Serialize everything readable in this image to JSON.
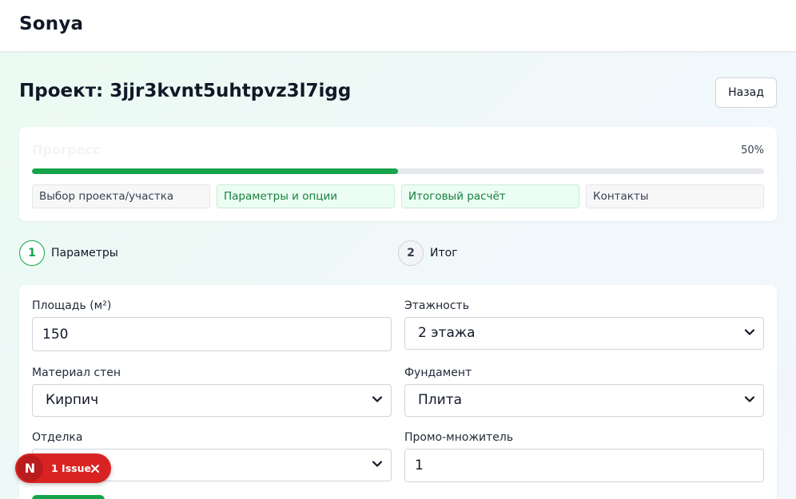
{
  "header": {
    "brand": "Sonya"
  },
  "page": {
    "title": "Проект: 3jjr3kvnt5uhtpvz3l7igg",
    "back_label": "Назад"
  },
  "progress": {
    "label": "Прогресс",
    "percent_text": "50%",
    "value": 0.5,
    "steps": [
      {
        "label": "Выбор проекта/участка",
        "active": false
      },
      {
        "label": "Параметры и опции",
        "active": true
      },
      {
        "label": "Итоговый расчёт",
        "active": true
      },
      {
        "label": "Контакты",
        "active": false
      }
    ]
  },
  "stepper": [
    {
      "number": "1",
      "label": "Параметры",
      "state": "current"
    },
    {
      "number": "2",
      "label": "Итог",
      "state": "pending"
    }
  ],
  "form": {
    "area": {
      "label": "Площадь (м²)",
      "value": "150"
    },
    "floors": {
      "label": "Этажность",
      "value": "2 этажа"
    },
    "wall_material": {
      "label": "Материал стен",
      "value": "Кирпич"
    },
    "foundation": {
      "label": "Фундамент",
      "value": "Плита"
    },
    "finishing": {
      "label": "Отделка",
      "value": ""
    },
    "promo": {
      "label": "Промо-множитель",
      "value": "1"
    }
  },
  "issues": {
    "avatar": "N",
    "text": "1 Issue"
  },
  "colors": {
    "accent": "#16a34a",
    "issue_red": "#d92323"
  }
}
